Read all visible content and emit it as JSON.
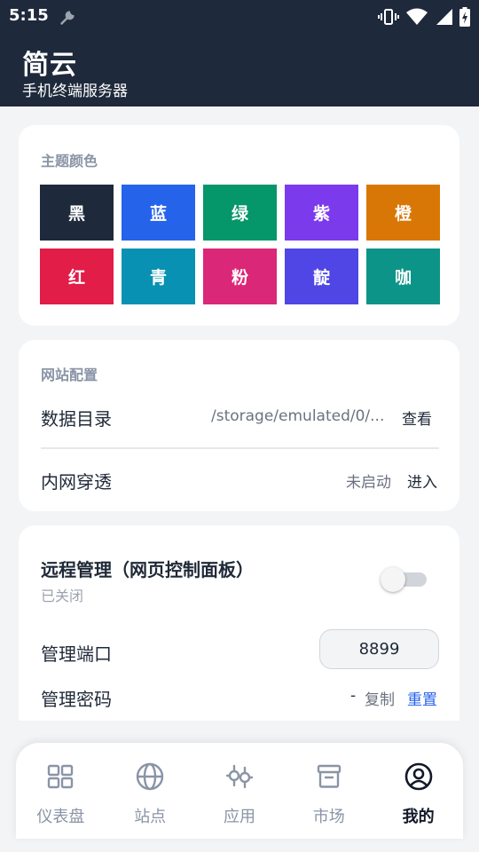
{
  "status_bar": {
    "time": "5:15"
  },
  "header": {
    "title": "简云",
    "subtitle": "手机终端服务器"
  },
  "theme": {
    "label": "主题颜色",
    "swatches": [
      {
        "label": "黑",
        "color": "#1e293b",
        "selected": true
      },
      {
        "label": "蓝",
        "color": "#2563eb"
      },
      {
        "label": "绿",
        "color": "#059669"
      },
      {
        "label": "紫",
        "color": "#7c3aed"
      },
      {
        "label": "橙",
        "color": "#d97706"
      },
      {
        "label": "红",
        "color": "#e11d48"
      },
      {
        "label": "青",
        "color": "#0891b2"
      },
      {
        "label": "粉",
        "color": "#db2777"
      },
      {
        "label": "靛",
        "color": "#4f46e5"
      },
      {
        "label": "咖",
        "color": "#0d9488"
      }
    ]
  },
  "site_config": {
    "label": "网站配置",
    "data_dir": {
      "label": "数据目录",
      "value": "/storage/emulated/0/...",
      "action": "查看"
    },
    "intranet": {
      "label": "内网穿透",
      "status": "未启动",
      "action": "进入"
    }
  },
  "remote": {
    "title": "远程管理（网页控制面板）",
    "status": "已关闭",
    "enabled": false,
    "port_label": "管理端口",
    "port_value": "8899",
    "password_label": "管理密码",
    "password_value": "-",
    "copy_label": "复制",
    "reset_label": "重置"
  },
  "nav": {
    "items": [
      {
        "label": "仪表盘",
        "icon": "dashboard-icon"
      },
      {
        "label": "站点",
        "icon": "globe-icon"
      },
      {
        "label": "应用",
        "icon": "apps-icon"
      },
      {
        "label": "市场",
        "icon": "archive-icon"
      },
      {
        "label": "我的",
        "icon": "user-icon",
        "active": true
      }
    ]
  },
  "colors": {
    "header_bg": "#1e293b",
    "accent": "#2563eb",
    "page_bg": "#f3f4f6"
  }
}
